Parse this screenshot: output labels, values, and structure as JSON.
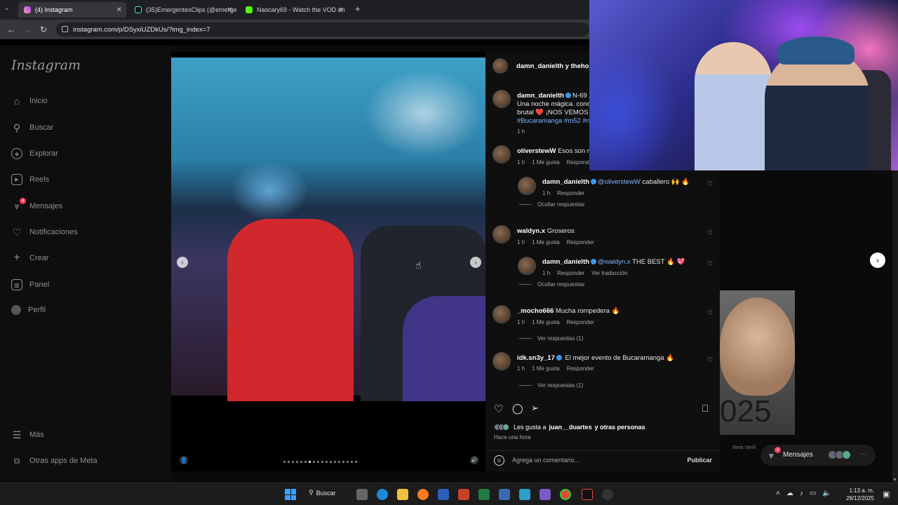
{
  "browser": {
    "tabs": [
      {
        "label": "(4) Instagram",
        "active": true
      },
      {
        "label": "(35)EmergentesClips (@emerge",
        "active": false
      },
      {
        "label": "Nascary69 - Watch the VOD on",
        "active": false
      }
    ],
    "new_tab": "+",
    "url": "instagram.com/p/DSyxiUZDkUs/?img_index=7"
  },
  "sidebar": {
    "logo": "Instagram",
    "items": [
      {
        "label": "Inicio",
        "icon": "home-icon"
      },
      {
        "label": "Buscar",
        "icon": "search-icon"
      },
      {
        "label": "Explorar",
        "icon": "compass-icon"
      },
      {
        "label": "Reels",
        "icon": "reels-icon"
      },
      {
        "label": "Mensajes",
        "icon": "messenger-icon",
        "badge": "4"
      },
      {
        "label": "Notificaciones",
        "icon": "heart-icon"
      },
      {
        "label": "Crear",
        "icon": "plus-icon"
      },
      {
        "label": "Panel",
        "icon": "chart-icon"
      },
      {
        "label": "Perfil",
        "icon": "profile-avatar"
      }
    ],
    "more": "Más",
    "meta_apps": "Otras apps de Meta"
  },
  "post": {
    "header": "damn_danielth y thehost",
    "caption": {
      "user": "damn_danielth",
      "line1": "N-69 X",
      "line2": "Una noche mágica. conoc",
      "line3": "brutal ❤️ ¡NOS VEMOS E",
      "tags": "#Bucaramanga #m52 #ni",
      "time": "1 h"
    },
    "comments": [
      {
        "user": "oliverstewW",
        "text": "Esos son mis",
        "time": "1 h",
        "likes": "1 Me gusta",
        "reply": "Responder"
      },
      {
        "user": "damn_danielth",
        "mention": "@oliverstewW",
        "text": "caballero 🙌 🔥",
        "time": "1 h",
        "reply": "Responder",
        "hide": "Ocultar respuestas"
      },
      {
        "user": "waldyn.x",
        "text": "Groseros",
        "time": "1 h",
        "likes": "1 Me gusta",
        "reply": "Responder"
      },
      {
        "user": "damn_danielth",
        "mention": "@waldyn.x",
        "text": "THE BEST 🔥 💖",
        "time": "1 h",
        "reply": "Responder",
        "translate": "Ver traducción",
        "hide": "Ocultar respuestas"
      },
      {
        "user": "_mocho666",
        "text": "Mucha rompedera 🔥",
        "time": "1 h",
        "likes": "1 Me gusta",
        "reply": "Responder",
        "view": "Ver respuestas (1)"
      },
      {
        "user": "idk.sn3y_17",
        "text": "El mejor evento de Bucaramanga 🔥",
        "time": "1 h",
        "likes": "1 Me gusta",
        "reply": "Responder",
        "view": "Ver respuestas (1)"
      }
    ],
    "likes_prefix": "Les gusta a",
    "likes_user": "juan__duartes",
    "likes_suffix": "y otras personas",
    "time_ago": "Hace una hora",
    "comment_placeholder": "Agrega un comentario...",
    "publish": "Publicar",
    "carousel_dots": 18,
    "carousel_active": 7
  },
  "background": {
    "year": "025",
    "meta_verified": "Meta Verifi",
    "messages_pill": "Mensajes",
    "messages_badge": "4"
  },
  "taskbar": {
    "search": "Buscar",
    "time": "1:13 a. m.",
    "date": "28/12/2025"
  },
  "colors": {
    "accent": "#3897f0",
    "badge": "#ff3b5c"
  }
}
